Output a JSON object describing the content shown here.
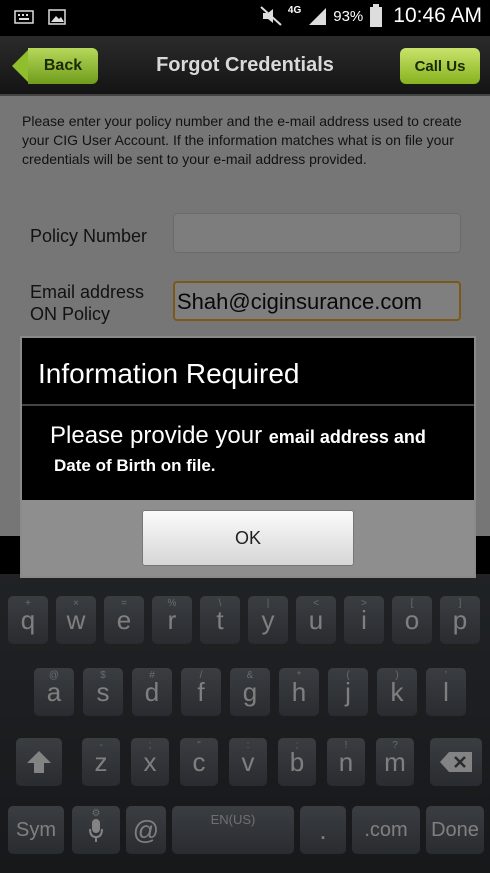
{
  "status_bar": {
    "network": "4G",
    "battery": "93%",
    "time": "10:46 AM"
  },
  "header": {
    "back_label": "Back",
    "title": "Forgot Credentials",
    "call_label": "Call Us"
  },
  "form": {
    "intro": "Please enter your policy number and the e-mail address used to create your CIG User Account.  If the information matches what is on file your credentials will be sent to your e-mail address provided.",
    "policy_label": "Policy Number",
    "policy_value": "",
    "email_label_1": "Email address",
    "email_label_2": "ON Policy",
    "email_value": "Shah@ciginsurance.com"
  },
  "dialog": {
    "title": "Information Required",
    "message_1": "Please provide your ",
    "message_1_bold": "email address and",
    "message_2": "Date of Birth on file.",
    "ok_label": "OK"
  },
  "keyboard": {
    "row1": [
      {
        "k": "q",
        "h": "+"
      },
      {
        "k": "w",
        "h": "×"
      },
      {
        "k": "e",
        "h": "="
      },
      {
        "k": "r",
        "h": "%"
      },
      {
        "k": "t",
        "h": "\\"
      },
      {
        "k": "y",
        "h": "|"
      },
      {
        "k": "u",
        "h": "<"
      },
      {
        "k": "i",
        "h": ">"
      },
      {
        "k": "o",
        "h": "["
      },
      {
        "k": "p",
        "h": "]"
      }
    ],
    "row2": [
      {
        "k": "a",
        "h": "@"
      },
      {
        "k": "s",
        "h": "$"
      },
      {
        "k": "d",
        "h": "#"
      },
      {
        "k": "f",
        "h": "/"
      },
      {
        "k": "g",
        "h": "&"
      },
      {
        "k": "h",
        "h": "*"
      },
      {
        "k": "j",
        "h": "("
      },
      {
        "k": "k",
        "h": ")"
      },
      {
        "k": "l",
        "h": "'"
      }
    ],
    "row3": [
      {
        "k": "z",
        "h": "-"
      },
      {
        "k": "x",
        "h": ";"
      },
      {
        "k": "c",
        "h": "\""
      },
      {
        "k": "v",
        "h": ":"
      },
      {
        "k": "b",
        "h": ";"
      },
      {
        "k": "n",
        "h": "!"
      },
      {
        "k": "m",
        "h": "?"
      }
    ],
    "sym": "Sym",
    "at": "@",
    "space": "EN(US)",
    "period": ".",
    "dotcom": ".com",
    "done": "Done"
  }
}
